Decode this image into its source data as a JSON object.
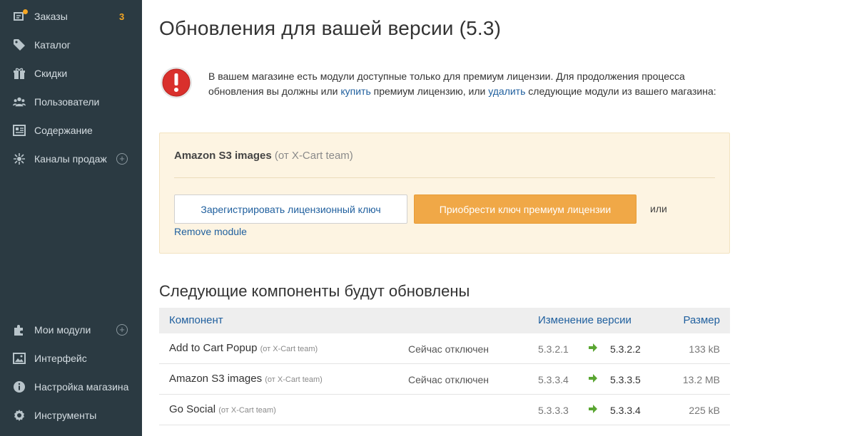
{
  "sidebar": {
    "items": [
      {
        "label": "Заказы",
        "icon": "orders-icon",
        "count": "3"
      },
      {
        "label": "Каталог",
        "icon": "tag-icon"
      },
      {
        "label": "Скидки",
        "icon": "gift-icon"
      },
      {
        "label": "Пользователи",
        "icon": "users-icon"
      },
      {
        "label": "Содержание",
        "icon": "content-icon"
      },
      {
        "label": "Каналы продаж",
        "icon": "sales-channels-icon",
        "plus": "+"
      },
      {
        "label": "Мои модули",
        "icon": "puzzle-icon",
        "plus": "+"
      },
      {
        "label": "Интерфейс",
        "icon": "image-icon"
      },
      {
        "label": "Настройка магазина",
        "icon": "info-icon"
      },
      {
        "label": "Инструменты",
        "icon": "gear-icon"
      }
    ]
  },
  "page": {
    "title": "Обновления для вашей версии (5.3)"
  },
  "alert": {
    "text_before": "В вашем магазине есть модули доступные только для премиум лицензии. Для продолжения процесса обновления вы должны или ",
    "buy_link": "купить",
    "text_middle": " премиум лицензию, или ",
    "remove_link": "удалить",
    "text_after": " следующие модули из вашего магазина:"
  },
  "module": {
    "name": "Amazon S3 images",
    "author": "(от X-Cart team)",
    "register_button": "Зарегистрировать лицензионный ключ",
    "buy_button": "Приобрести ключ премиум лицензии",
    "or_text": "или",
    "remove_link": "Remove module"
  },
  "components": {
    "title": "Следующие компоненты будут обновлены",
    "headers": {
      "component": "Компонент",
      "version_change": "Изменение версии",
      "size": "Размер"
    },
    "rows": [
      {
        "name": "Add to Cart Popup",
        "author": "(от X-Cart team)",
        "status": "Сейчас отключен",
        "old": "5.3.2.1",
        "new": "5.3.2.2",
        "size": "133 kB"
      },
      {
        "name": "Amazon S3 images",
        "author": "(от X-Cart team)",
        "status": "Сейчас отключен",
        "old": "5.3.3.4",
        "new": "5.3.3.5",
        "size": "13.2 MB"
      },
      {
        "name": "Go Social",
        "author": "(от X-Cart team)",
        "status": "",
        "old": "5.3.3.3",
        "new": "5.3.3.4",
        "size": "225 kB"
      }
    ]
  },
  "colors": {
    "sidebar_bg": "#2b3a42",
    "accent_orange": "#f0a847",
    "link_blue": "#1f5f9e",
    "arrow_green": "#5aa632",
    "alert_red": "#d9302c"
  }
}
